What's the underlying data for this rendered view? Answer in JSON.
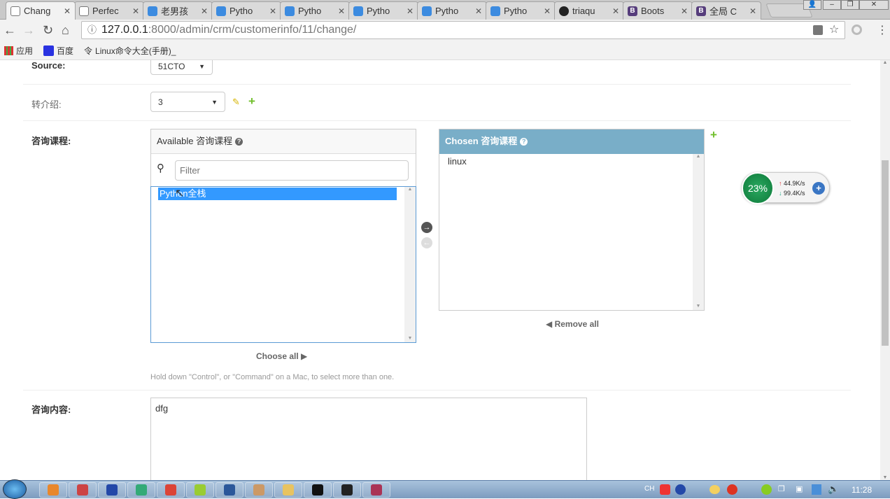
{
  "browser": {
    "tabs": [
      {
        "title": "Chang",
        "icon": "page-icon",
        "active": true
      },
      {
        "title": "Perfec",
        "icon": "page-icon"
      },
      {
        "title": "老男孩",
        "icon": "site-icon"
      },
      {
        "title": "Pytho",
        "icon": "site-icon"
      },
      {
        "title": "Pytho",
        "icon": "site-icon"
      },
      {
        "title": "Pytho",
        "icon": "site-icon"
      },
      {
        "title": "Pytho",
        "icon": "site-icon"
      },
      {
        "title": "Pytho",
        "icon": "site-icon"
      },
      {
        "title": "triaqu",
        "icon": "github-icon"
      },
      {
        "title": "Boots",
        "icon": "bootstrap-icon"
      },
      {
        "title": "全局 C",
        "icon": "bootstrap-icon"
      }
    ],
    "url_host": "127.0.0.1",
    "url_rest": ":8000/admin/crm/customerinfo/11/change/",
    "bookmarks": [
      {
        "label": "应用",
        "icon": "apps-icon"
      },
      {
        "label": "百度",
        "icon": "baidu-icon"
      },
      {
        "label": "Linux命令大全(手册)_",
        "icon": "linux-icon"
      }
    ]
  },
  "form": {
    "source_label": "Source:",
    "source_value": "51CTO",
    "referral_label": "转介绍:",
    "referral_value": "3",
    "course_label": "咨询课程:",
    "available_title": "Available 咨询课程",
    "filter_placeholder": "Filter",
    "available_options": [
      "Python全栈"
    ],
    "chosen_title": "Chosen 咨询课程",
    "chosen_options": [
      "linux"
    ],
    "choose_all": "Choose all",
    "remove_all": "Remove all",
    "help_text": "Hold down \"Control\", or \"Command\" on a Mac, to select more than one.",
    "content_label": "咨询内容:",
    "content_value": "dfg",
    "accent_color": "#79aec8"
  },
  "net_widget": {
    "cpu": "23%",
    "upload": "44.9K/s",
    "download": "99.4K/s"
  },
  "taskbar": {
    "lang": "CH",
    "clock": "11:28"
  }
}
